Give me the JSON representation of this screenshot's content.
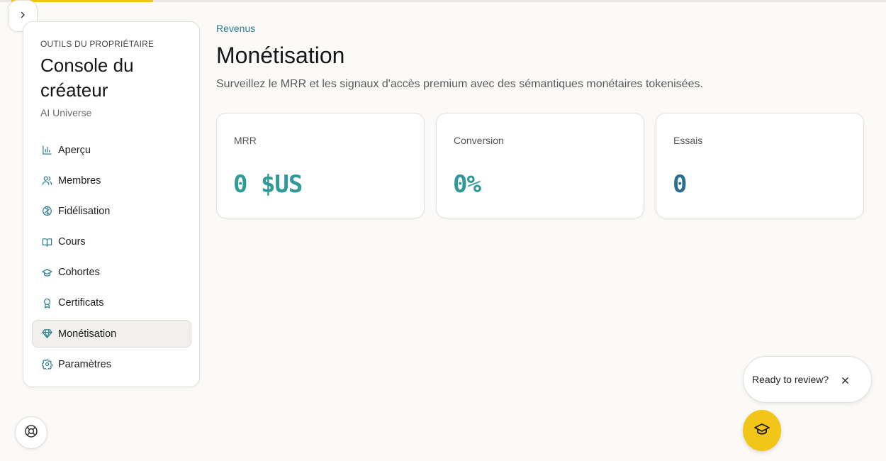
{
  "colors": {
    "accent_yellow": "#f2c418",
    "teal_kicker": "#2a7c8e",
    "teal_value": "#2f9a98",
    "blue_value": "#2a6f92"
  },
  "sidebar": {
    "kicker": "OUTILS DU PROPRIÉTAIRE",
    "title": "Console du créateur",
    "subtitle": "AI Universe",
    "items": [
      {
        "label": "Aperçu",
        "icon": "bar-chart-icon"
      },
      {
        "label": "Membres",
        "icon": "users-icon"
      },
      {
        "label": "Fidélisation",
        "icon": "brain-icon"
      },
      {
        "label": "Cours",
        "icon": "book-open-icon"
      },
      {
        "label": "Cohortes",
        "icon": "graduation-cap-icon"
      },
      {
        "label": "Certificats",
        "icon": "award-icon"
      },
      {
        "label": "Monétisation",
        "icon": "gem-icon",
        "active": true
      },
      {
        "label": "Paramètres",
        "icon": "gear-icon"
      }
    ]
  },
  "page": {
    "kicker": "Revenus",
    "title": "Monétisation",
    "subtitle": "Surveillez le MRR et les signaux d'accès premium avec des sémantiques monétaires tokenisées."
  },
  "metrics": [
    {
      "label": "MRR",
      "value": "0 $US"
    },
    {
      "label": "Conversion",
      "value": "0%"
    },
    {
      "label": "Essais",
      "value": "0"
    }
  ],
  "toast": {
    "text": "Ready to review?"
  }
}
